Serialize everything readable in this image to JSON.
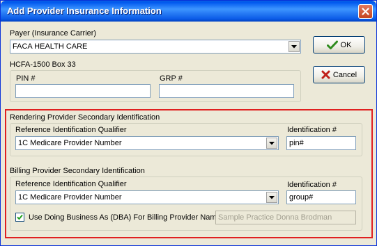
{
  "window": {
    "title": "Add Provider Insurance Information"
  },
  "payer": {
    "label": "Payer (Insurance Carrier)",
    "value": "FACA HEALTH CARE"
  },
  "buttons": {
    "ok": "OK",
    "cancel": "Cancel"
  },
  "hcfa": {
    "label": "HCFA-1500  Box 33",
    "pin_label": "PIN #",
    "pin_value": "",
    "grp_label": "GRP #",
    "grp_value": ""
  },
  "rendering": {
    "section_label": "Rendering Provider Secondary Identification",
    "qualifier_label": "Reference Identification Qualifier",
    "qualifier_value": "1C Medicare Provider Number",
    "id_label": "Identification #",
    "id_value": "pin#"
  },
  "billing": {
    "section_label": "Billing Provider Secondary Identification",
    "qualifier_label": "Reference Identification Qualifier",
    "qualifier_value": "1C Medicare Provider Number",
    "id_label": "Identification #",
    "id_value": "group#",
    "dba_label": "Use Doing Business As (DBA) For Billing Provider Name:",
    "dba_checked": true,
    "dba_value": "Sample Practice Donna Brodman"
  },
  "colors": {
    "highlight_frame": "#e02020",
    "titlebar": "#0058ee"
  },
  "icons": {
    "ok": "checkmark-icon",
    "cancel": "x-icon",
    "close": "close-icon",
    "dropdown": "chevron-down-icon"
  }
}
